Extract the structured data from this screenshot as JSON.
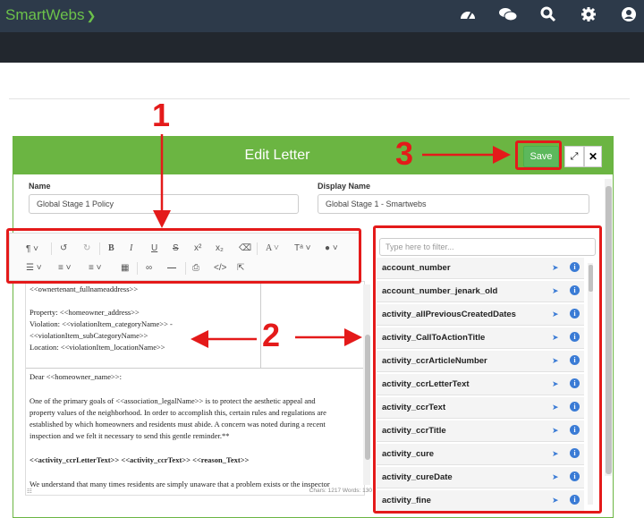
{
  "app": {
    "brand": "SmartWebs"
  },
  "topbar_icons": [
    "dashboard-icon",
    "chat-icon",
    "search-icon",
    "gear-icon",
    "user-icon"
  ],
  "modal": {
    "title": "Edit Letter",
    "save_label": "Save",
    "expand_label": "⤢",
    "close_label": "✕"
  },
  "form": {
    "name_label": "Name",
    "name_value": "Global Stage 1  Policy",
    "display_name_label": "Display Name",
    "display_name_value": "Global Stage 1 - Smartwebs"
  },
  "editor": {
    "line1": "<<ownertenant_fullnameaddress>>",
    "line2": "Property: <<homeowner_address>>",
    "line3": "Violation: <<violationItem_categoryName>> -",
    "line4": "<<violationItem_subCategoryName>>",
    "line5": "Location: <<violationItem_locationName>>",
    "greeting": "Dear <<homeowner_name>>:",
    "para1a": "One of the primary goals of <<association_legalName>> is to protect the aesthetic appeal and",
    "para1b": "property values of the neighborhood. In order to accomplish this, certain rules and regulations are",
    "para1c": "established by which homeowners and residents must abide. A concern was noted during a recent",
    "para1d": "inspection and we felt it necessary to send this gentle reminder.**",
    "fields_line": "<<activity_ccrLetterText>> <<activity_ccrText>> <<reason_Text>>",
    "para2": "We understand that many times residents are simply unaware that a problem exists or the inspector",
    "status": "Chars: 1217  Words: 130"
  },
  "filter": {
    "placeholder": "Type here to filter..."
  },
  "fields": [
    "account_number",
    "account_number_jenark_old",
    "activity_allPreviousCreatedDates",
    "activity_CallToActionTitle",
    "activity_ccrArticleNumber",
    "activity_ccrLetterText",
    "activity_ccrText",
    "activity_ccrTitle",
    "activity_cure",
    "activity_cureDate",
    "activity_fine"
  ],
  "annotations": {
    "one": "1",
    "two": "2",
    "three": "3"
  },
  "colors": {
    "accent_green": "#6bb542",
    "annotation_red": "#e41a1a",
    "topbar": "#2d3a4a"
  }
}
